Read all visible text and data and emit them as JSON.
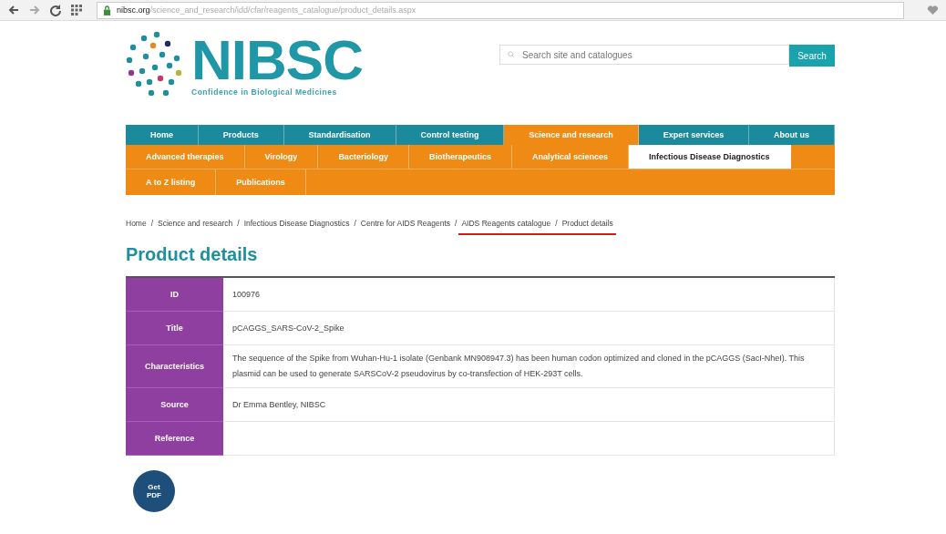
{
  "browser": {
    "url_domain": "nibsc.org",
    "url_path": "/science_and_research/idd/cfar/reagents_catalogue/product_details.aspx"
  },
  "logo": {
    "name": "NIBSC",
    "tagline": "Confidence in Biological Medicines"
  },
  "search": {
    "placeholder": "Search site and catalogues",
    "button": "Search"
  },
  "nav_rows": [
    [
      {
        "label": "Home",
        "selected": false
      },
      {
        "label": "Products",
        "selected": false
      },
      {
        "label": "Standardisation",
        "selected": false
      },
      {
        "label": "Control testing",
        "selected": false
      },
      {
        "label": "Science and research",
        "selected": true
      },
      {
        "label": "Expert services",
        "selected": false
      },
      {
        "label": "About us",
        "selected": false
      }
    ],
    [
      {
        "label": "Advanced therapies",
        "selected": false
      },
      {
        "label": "Virology",
        "selected": false
      },
      {
        "label": "Bacteriology",
        "selected": false
      },
      {
        "label": "Biotherapeutics",
        "selected": false
      },
      {
        "label": "Analytical sciences",
        "selected": false
      },
      {
        "label": "Infectious Disease Diagnostics",
        "selected": true
      }
    ],
    [
      {
        "label": "A to Z listing",
        "selected": false
      },
      {
        "label": "Publications",
        "selected": false
      }
    ]
  ],
  "breadcrumb": [
    {
      "label": "Home",
      "underlined": false
    },
    {
      "separator": "/",
      "label": "Science and research",
      "underlined": false
    },
    {
      "separator": "/",
      "label": "Infectious Disease Diagnostics",
      "underlined": false
    },
    {
      "separator": "/",
      "label": "Centre for AIDS Reagents",
      "underlined": false
    },
    {
      "separator": "/",
      "label": "AIDS Reagents catalogue",
      "underlined": true
    },
    {
      "separator": "/",
      "label": "Product details",
      "underlined": true
    }
  ],
  "heading": "Product details",
  "details": [
    {
      "label": "ID",
      "value": "100976"
    },
    {
      "label": "Title",
      "value": "pCAGGS_SARS-CoV-2_Spike"
    },
    {
      "label": "Characteristics",
      "value": "The sequence of the Spike from Wuhan-Hu-1 isolate (Genbank MN908947.3) has been human codon optimized and cloned in the pCAGGS (SacI-NheI). This plasmid can be used to generate SARSCoV-2 pseudovirus by co-transfection of HEK-293T cells."
    },
    {
      "label": "Source",
      "value": "Dr Emma Bentley, NIBSC"
    },
    {
      "label": "Reference"
    }
  ],
  "pdf_button": {
    "line1": "Get",
    "line2": "PDF"
  }
}
